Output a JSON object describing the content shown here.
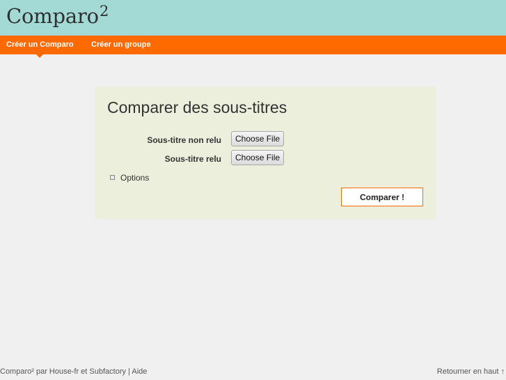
{
  "header": {
    "logo_text": "Comparo",
    "logo_sup": "2"
  },
  "nav": {
    "items": [
      {
        "label": "Créer un Comparo",
        "active": true
      },
      {
        "label": "Créer un groupe",
        "active": false
      }
    ]
  },
  "panel": {
    "title": "Comparer des sous-titres",
    "fields": [
      {
        "label": "Sous-titre non relu",
        "button": "Choose File"
      },
      {
        "label": "Sous-titre relu",
        "button": "Choose File"
      }
    ],
    "options_label": "Options",
    "submit_label": "Comparer !"
  },
  "footer": {
    "prefix": "Comparo² par ",
    "house_link": "House-fr",
    "et": " et ",
    "subfactory_link": "Subfactory",
    "separator": " | ",
    "aide_link": "Aide",
    "back_to_top": "Retourner en haut ↑"
  },
  "colors": {
    "header_bg": "#a3dad5",
    "nav_bg": "#ff6a00",
    "panel_bg": "#ecefdb",
    "page_bg": "#f0f0f0"
  }
}
